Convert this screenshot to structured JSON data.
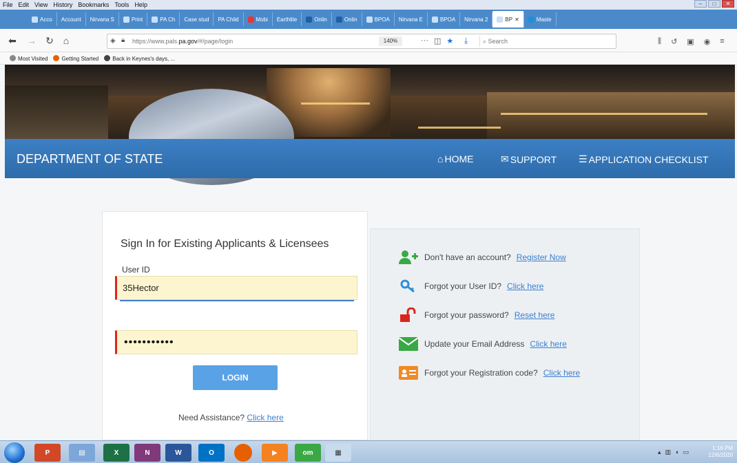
{
  "menubar": {
    "items": [
      "File",
      "Edit",
      "View",
      "History",
      "Bookmarks",
      "Tools",
      "Help"
    ]
  },
  "tabs": [
    "Acco",
    "Account",
    "Nirvana S",
    "Print",
    "PA Ch",
    "Case stud",
    "PA Child",
    "Mobi",
    "Earthlite",
    "Onlin",
    "Onlin",
    "BPOA",
    "Nirvana E",
    "BPOA",
    "Nirvana 2",
    "BP",
    "Maste"
  ],
  "browser": {
    "url_prefix": "https://www.pals.",
    "url_domain": "pa.gov",
    "url_suffix": "/#/page/login",
    "zoom": "140%",
    "search_placeholder": "Search"
  },
  "bookmarks": {
    "items": [
      "Most Visited",
      "Getting Started",
      "Back in Keynes's days, ..."
    ]
  },
  "header": {
    "title": "DEPARTMENT OF STATE",
    "home": "HOME",
    "support": "SUPPORT",
    "checklist": "APPLICATION CHECKLIST"
  },
  "login": {
    "title": "Sign In for Existing Applicants & Licensees",
    "userid_label": "User ID",
    "userid_value": "35Hector",
    "password_value": "•••••••••••",
    "login_button": "LOGIN",
    "assist_text": "Need Assistance?",
    "assist_link": "Click here"
  },
  "help": {
    "register_text": "Don't have an account?",
    "register_link": "Register Now",
    "forgot_user_text": "Forgot your User ID?",
    "forgot_user_link": "Click here",
    "forgot_pw_text": "Forgot your password?",
    "forgot_pw_link": "Reset here",
    "email_text": "Update your Email Address",
    "email_link": "Click here",
    "regcode_text": "Forgot your Registration code?",
    "regcode_link": "Click here"
  },
  "taskbar": {
    "apps": [
      "P",
      "X",
      "N",
      "W",
      "O",
      "om"
    ],
    "time": "1:16 PM",
    "date": "12/6/2020"
  },
  "colors": {
    "brand_blue": "#3c7fc4",
    "link": "#3b7fcf",
    "button": "#5aa2e6",
    "input_bg": "#fdf5cf",
    "error_border": "#d9261c"
  }
}
